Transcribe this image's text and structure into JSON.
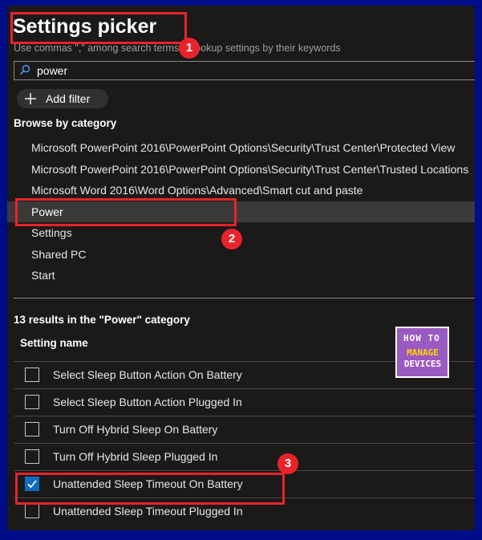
{
  "header": {
    "title": "Settings picker",
    "hint": "Use commas \",\" among search terms to lookup settings by their keywords"
  },
  "search": {
    "value": "power",
    "icon": "search-icon"
  },
  "add_filter": {
    "label": "Add filter"
  },
  "browse": {
    "heading": "Browse by category",
    "items": [
      {
        "label": "Microsoft PowerPoint 2016\\PowerPoint Options\\Security\\Trust Center\\Protected View"
      },
      {
        "label": "Microsoft PowerPoint 2016\\PowerPoint Options\\Security\\Trust Center\\Trusted Locations"
      },
      {
        "label": "Microsoft Word 2016\\Word Options\\Advanced\\Smart cut and paste"
      },
      {
        "label": "Power"
      },
      {
        "label": "Settings"
      },
      {
        "label": "Shared PC"
      },
      {
        "label": "Start"
      }
    ],
    "selected": "Power"
  },
  "results": {
    "summary": "13 results in the \"Power\" category",
    "column_header": "Setting name",
    "rows": [
      {
        "name": "Select Sleep Button Action On Battery",
        "checked": false
      },
      {
        "name": "Select Sleep Button Action Plugged In",
        "checked": false
      },
      {
        "name": "Turn Off Hybrid Sleep On Battery",
        "checked": false
      },
      {
        "name": "Turn Off Hybrid Sleep Plugged In",
        "checked": false
      },
      {
        "name": "Unattended Sleep Timeout On Battery",
        "checked": true
      },
      {
        "name": "Unattended Sleep Timeout Plugged In",
        "checked": false
      }
    ]
  },
  "annotations": {
    "badge1": "1",
    "badge2": "2",
    "badge3": "3",
    "color": "#e8232a"
  },
  "logo": {
    "line1": "HOW TO",
    "line2": "MANAGE",
    "line3": "DEVICES"
  },
  "colors": {
    "frame": "#000d8a",
    "panel": "#1b1a19",
    "selected_row": "#3b3a39",
    "checkbox_checked": "#0f6cbd"
  }
}
